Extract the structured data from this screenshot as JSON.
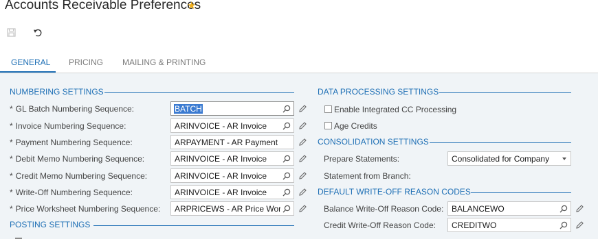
{
  "header": {
    "title": "Accounts Receivable Preferences"
  },
  "toolbar": {
    "save_icon": "save-icon",
    "undo_icon": "undo-icon"
  },
  "tabs": [
    {
      "label": "GENERAL",
      "active": true
    },
    {
      "label": "PRICING",
      "active": false
    },
    {
      "label": "MAILING & PRINTING",
      "active": false
    }
  ],
  "numbering": {
    "header": "NUMBERING SETTINGS",
    "rows": [
      {
        "label": "GL Batch Numbering Sequence:",
        "value": "BATCH"
      },
      {
        "label": "Invoice Numbering Sequence:",
        "value": "ARINVOICE - AR Invoice"
      },
      {
        "label": "Payment Numbering Sequence:",
        "value": "ARPAYMENT - AR Payment"
      },
      {
        "label": "Debit Memo Numbering Sequence:",
        "value": "ARINVOICE - AR Invoice"
      },
      {
        "label": "Credit Memo Numbering Sequence:",
        "value": "ARINVOICE - AR Invoice"
      },
      {
        "label": "Write-Off Numbering Sequence:",
        "value": "ARINVOICE - AR Invoice"
      },
      {
        "label": "Price Worksheet Numbering Sequence:",
        "value": "ARPRICEWS - AR Price Worl"
      }
    ]
  },
  "posting": {
    "header": "POSTING SETTINGS"
  },
  "data_processing": {
    "header": "DATA PROCESSING SETTINGS",
    "enable_cc_label": "Enable Integrated CC Processing",
    "age_credits_label": "Age Credits"
  },
  "consolidation": {
    "header": "CONSOLIDATION SETTINGS",
    "prepare_label": "Prepare Statements:",
    "prepare_value": "Consolidated for Company",
    "branch_label": "Statement from Branch:"
  },
  "writeoff": {
    "header": "DEFAULT WRITE-OFF REASON CODES",
    "balance_label": "Balance Write-Off Reason Code:",
    "balance_value": "BALANCEWO",
    "credit_label": "Credit Write-Off Reason Code:",
    "credit_value": "CREDITWO"
  },
  "colors": {
    "accent": "#1e6fb5",
    "star": "#f2b01e",
    "panel_bg": "#f0f4f7"
  }
}
